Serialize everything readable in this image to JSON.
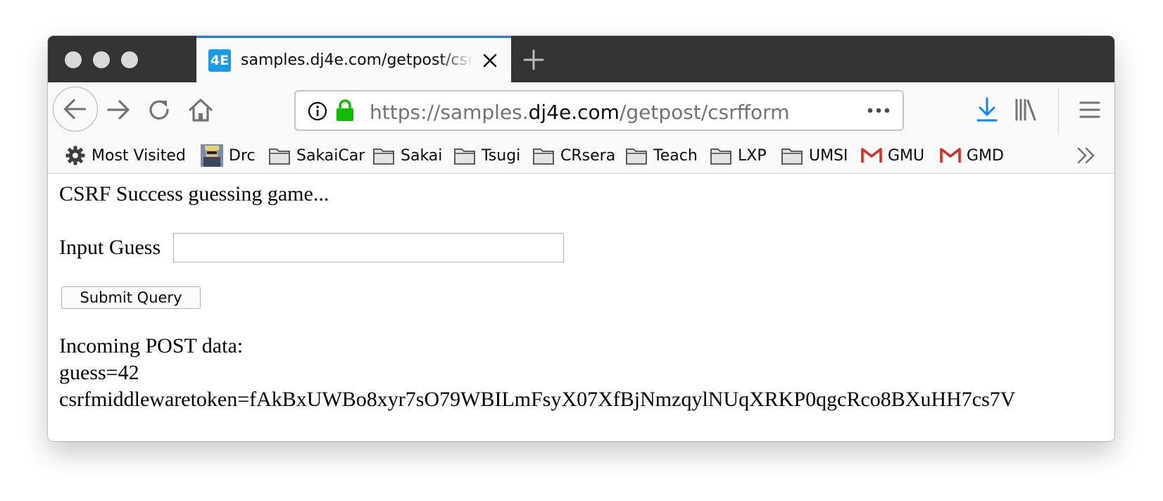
{
  "browser": {
    "tab": {
      "favicon_text": "4E",
      "title": "samples.dj4e.com/getpost/csrfform"
    },
    "url": {
      "prefix": "https://samples.",
      "domain": "dj4e.com",
      "path": "/getpost/csrfform"
    },
    "bookmarks": [
      {
        "label": "Most Visited",
        "icon": "gear-icon"
      },
      {
        "label": "Drc",
        "icon": "avatar-icon"
      },
      {
        "label": "SakaiCar",
        "icon": "folder-icon"
      },
      {
        "label": "Sakai",
        "icon": "folder-icon"
      },
      {
        "label": "Tsugi",
        "icon": "folder-icon"
      },
      {
        "label": "CRsera",
        "icon": "folder-icon"
      },
      {
        "label": "Teach",
        "icon": "folder-icon"
      },
      {
        "label": "LXP",
        "icon": "folder-icon"
      },
      {
        "label": "UMSI",
        "icon": "folder-icon"
      },
      {
        "label": "GMU",
        "icon": "gmail-icon"
      },
      {
        "label": "GMD",
        "icon": "gmail-icon"
      }
    ],
    "colors": {
      "tab_accent": "#0a84ff",
      "download": "#0a84ff",
      "lock": "#12bc00",
      "titlebar": "#333333"
    }
  },
  "page": {
    "heading": "CSRF Success guessing game...",
    "guess_label": "Input Guess",
    "guess_value": "",
    "submit_label": "Submit Query",
    "post_title": "Incoming POST data:",
    "post_lines": [
      "guess=42",
      "csrfmiddlewaretoken=fAkBxUWBo8xyr7sO79WBILmFsyX07XfBjNmzqylNUqXRKP0qgcRco8BXuHH7cs7V"
    ]
  }
}
